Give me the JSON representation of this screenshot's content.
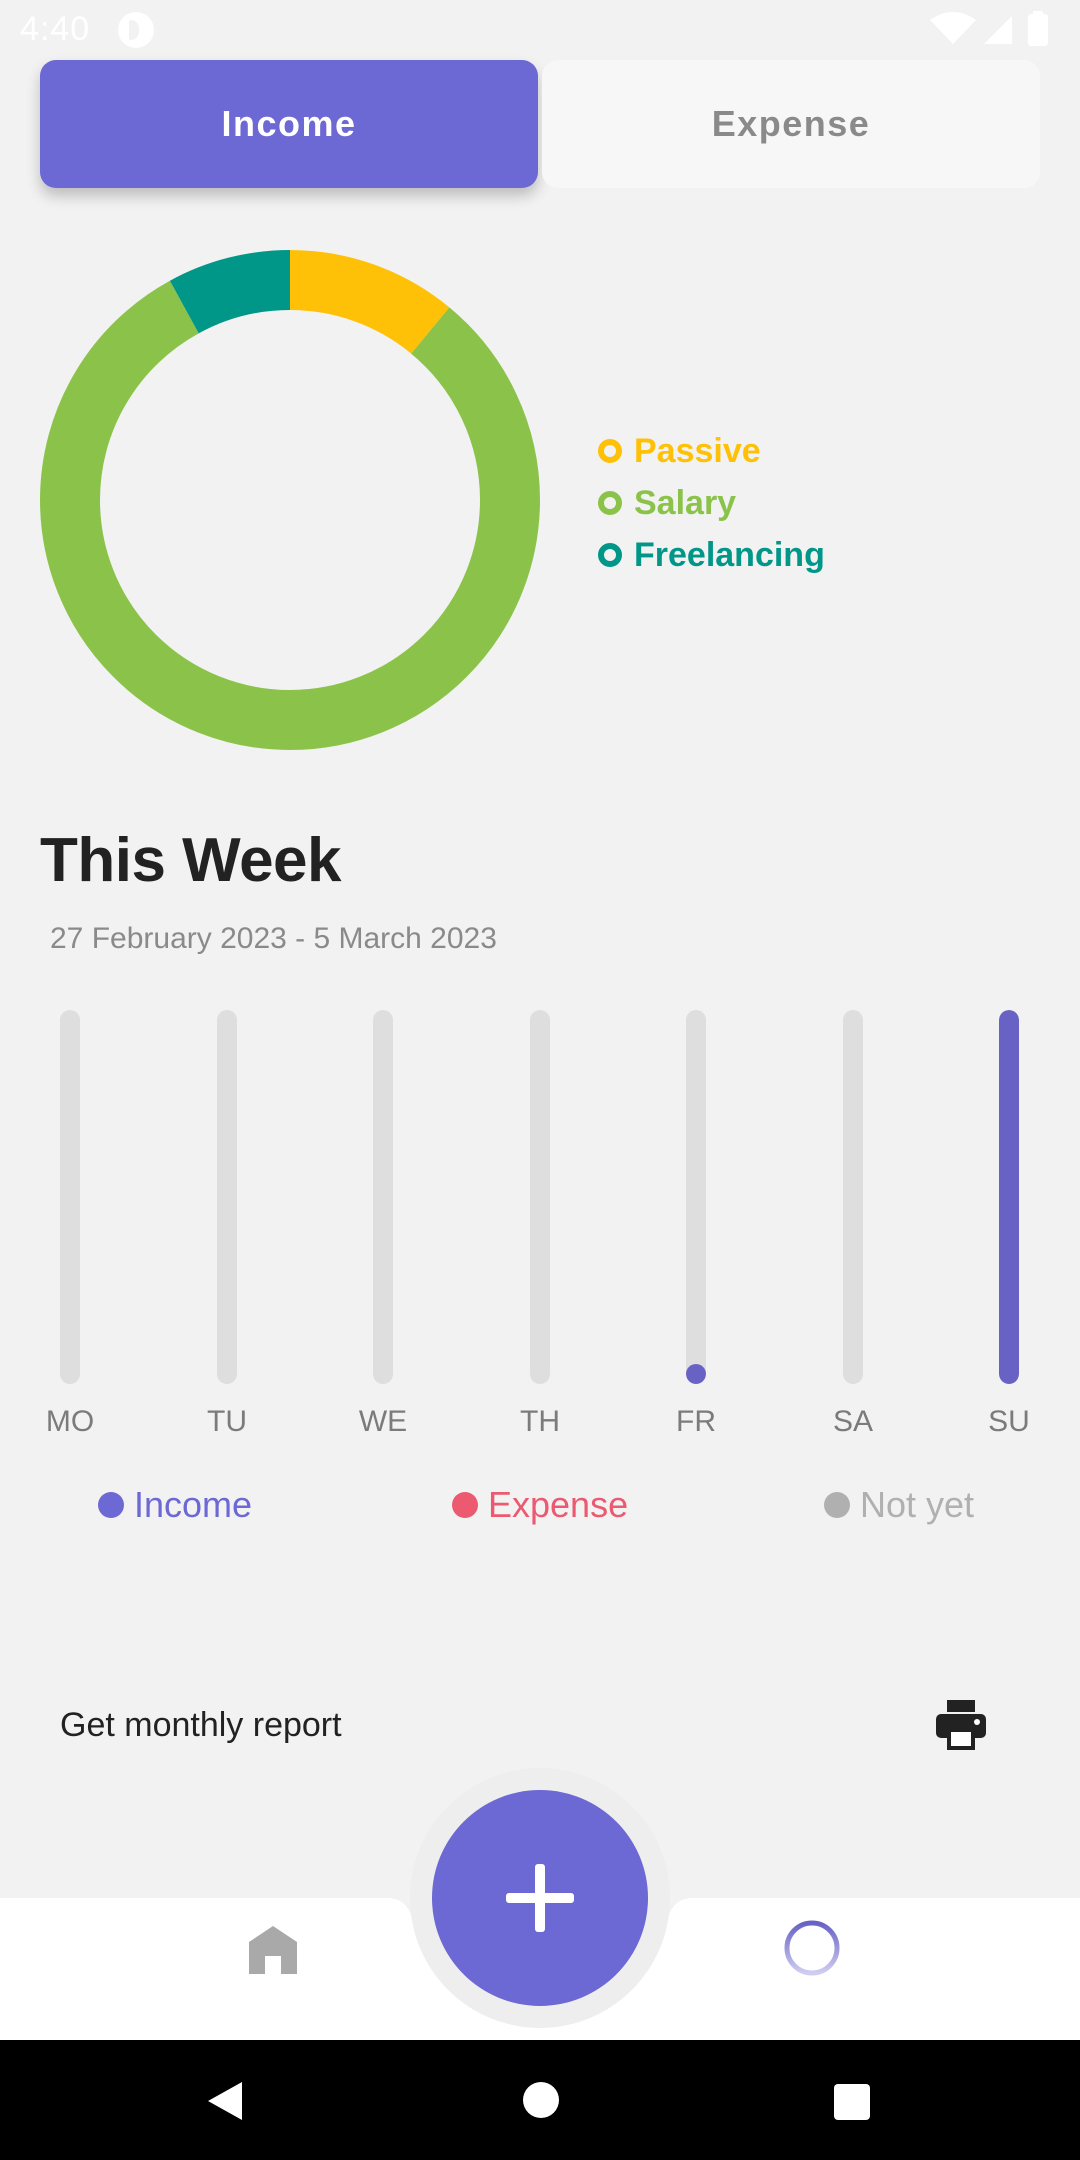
{
  "status_bar": {
    "time": "4:40"
  },
  "toggle": {
    "income_label": "Income",
    "expense_label": "Expense",
    "selected": "Income"
  },
  "chart_data": [
    {
      "type": "pie",
      "variant": "donut",
      "series": [
        {
          "name": "Passive",
          "value": 11,
          "color": "#ffc107"
        },
        {
          "name": "Salary",
          "value": 81,
          "color": "#8bc34a"
        },
        {
          "name": "Freelancing",
          "value": 8,
          "color": "#009688"
        }
      ],
      "legend_position": "right"
    },
    {
      "type": "bar",
      "title": "This Week",
      "subtitle": "27 February 2023 - 5 March 2023",
      "categories": [
        "MO",
        "TU",
        "WE",
        "TH",
        "FR",
        "SA",
        "SU"
      ],
      "values": [
        0,
        0,
        0,
        0,
        0.04,
        0,
        1.0
      ],
      "ylim": [
        0,
        1
      ],
      "fill_color": "#6762c4",
      "track_color": "#dedede"
    }
  ],
  "week": {
    "title": "This Week",
    "range": "27 February 2023 - 5 March 2023"
  },
  "status_legend": [
    {
      "label": "Income",
      "color": "#6c68d4"
    },
    {
      "label": "Expense",
      "color": "#eb5a70"
    },
    {
      "label": "Not yet",
      "color": "#b0b0b0"
    }
  ],
  "report": {
    "label": "Get monthly report",
    "icon": "printer-icon"
  },
  "bottom_nav": {
    "items": [
      {
        "name": "home",
        "icon": "home-icon",
        "active": false
      },
      {
        "name": "statistics",
        "icon": "pie-chart-icon",
        "active": true
      }
    ],
    "fab_icon": "plus-icon"
  },
  "colors": {
    "accent": "#6c68d4",
    "background": "#f2f2f2",
    "nav_background": "#ffffff"
  }
}
